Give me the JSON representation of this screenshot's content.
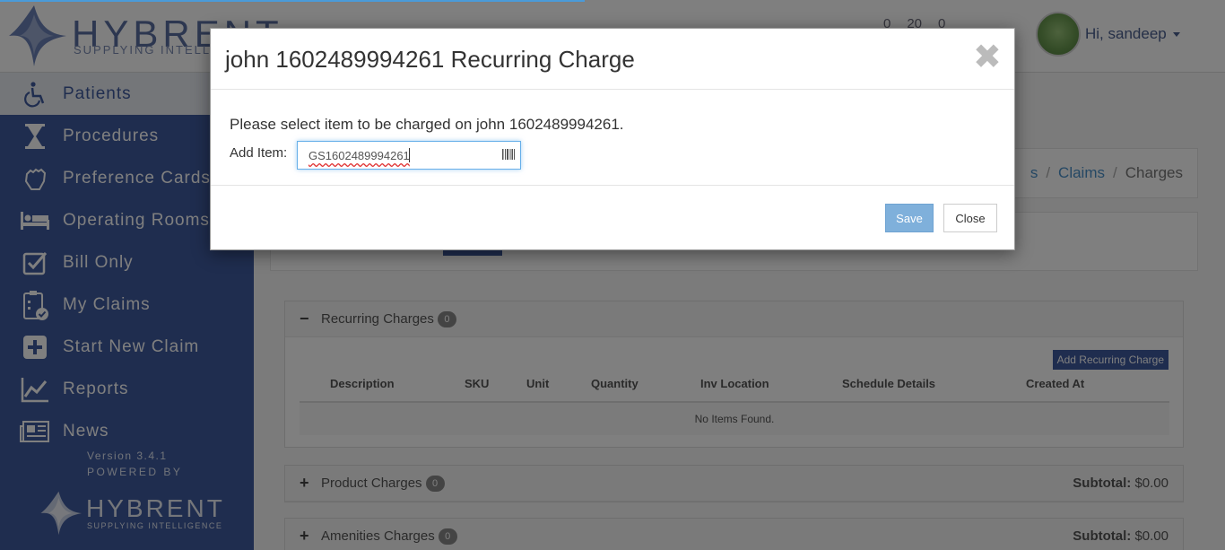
{
  "header": {
    "brand_name": "HYBRENT",
    "brand_tagline": "SUPPLYING INTELLIGENCE",
    "stats": [
      "0",
      "20",
      "0"
    ],
    "user_greeting": "Hi, sandeep"
  },
  "sidebar": {
    "items": [
      {
        "label": "Patients",
        "icon": "wheelchair-icon",
        "active": true
      },
      {
        "label": "Procedures",
        "icon": "hourglass-icon",
        "active": false
      },
      {
        "label": "Preference Cards",
        "icon": "hand-icon",
        "active": false
      },
      {
        "label": "Operating Rooms",
        "icon": "bed-icon",
        "active": false
      },
      {
        "label": "Bill Only",
        "icon": "checkbox-icon",
        "active": false
      },
      {
        "label": "My Claims",
        "icon": "clipboard-check-icon",
        "active": false
      },
      {
        "label": "Start New Claim",
        "icon": "plus-square-icon",
        "active": false
      },
      {
        "label": "Reports",
        "icon": "line-chart-icon",
        "active": false
      },
      {
        "label": "News",
        "icon": "newspaper-icon",
        "active": false
      }
    ],
    "version": "Version 3.4.1",
    "powered_by": "POWERED BY",
    "footer_brand": "HYBRENT",
    "footer_tagline": "SUPPLYING INTELLIGENCE"
  },
  "breadcrumb": {
    "partial": "s",
    "claims": "Claims",
    "current": "Charges"
  },
  "recurring": {
    "title": "Recurring Charges",
    "count": "0",
    "add_button": "Add Recurring Charge",
    "columns": [
      "Description",
      "SKU",
      "Unit",
      "Quantity",
      "Inv Location",
      "Schedule Details",
      "Created At"
    ],
    "empty": "No Items Found."
  },
  "product": {
    "title": "Product Charges",
    "count": "0",
    "subtotal_label": "Subtotal:",
    "subtotal_value": "$0.00"
  },
  "amenities": {
    "title": "Amenities Charges",
    "count": "0",
    "subtotal_label": "Subtotal:",
    "subtotal_value": "$0.00"
  },
  "modal": {
    "title": "john 1602489994261 Recurring Charge",
    "close_symbol": "✖",
    "message": "Please select item to be charged on john 1602489994261.",
    "add_item_label": "Add Item:",
    "item_value": "GS1602489994261",
    "save": "Save",
    "close": "Close"
  }
}
